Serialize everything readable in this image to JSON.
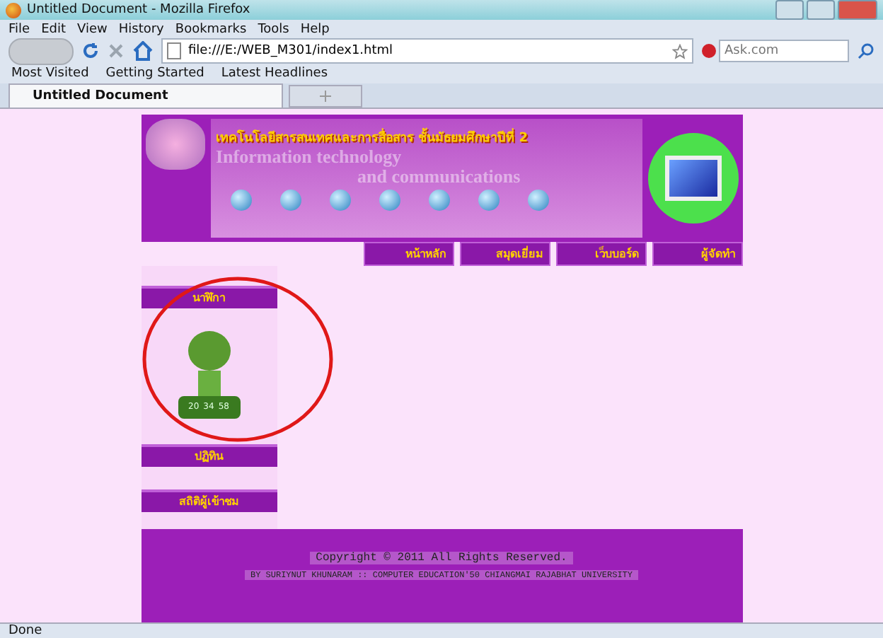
{
  "window": {
    "title": "Untitled Document - Mozilla Firefox"
  },
  "menu": [
    "File",
    "Edit",
    "View",
    "History",
    "Bookmarks",
    "Tools",
    "Help"
  ],
  "address": {
    "value": "file:///E:/WEB_M301/index1.html"
  },
  "search": {
    "placeholder": "Ask.com"
  },
  "bookmarks": [
    "Most Visited",
    "Getting Started",
    "Latest Headlines"
  ],
  "tabs": [
    {
      "label": "Untitled Document",
      "selected": true
    }
  ],
  "page": {
    "header": {
      "title": "เทคโนโลยีสารสนเทศและการสื่อสาร ชั้นมัธยมศึกษาปีที่ 2",
      "watermark_1": "Information technology",
      "watermark_2": "and communications"
    },
    "nav": [
      "หน้าหลัก",
      "สมุดเยี่ยม",
      "เว็บบอร์ด",
      "ผู้จัดทำ"
    ],
    "sidebar": [
      {
        "kind": "clock",
        "label": "นาฬิกา",
        "time": [
          "20",
          "34",
          "58"
        ]
      },
      {
        "kind": "plain",
        "label": "ปฏิทิน"
      },
      {
        "kind": "plain",
        "label": "สถิติผู้เข้าชม"
      }
    ],
    "footer": [
      "Copyright © 2011 All Rights Reserved.",
      "BY SURIYNUT KHUNARAM :: COMPUTER EDUCATION'50  CHIANGMAI RAJABHAT UNIVERSITY"
    ]
  },
  "status_bar": "Done"
}
